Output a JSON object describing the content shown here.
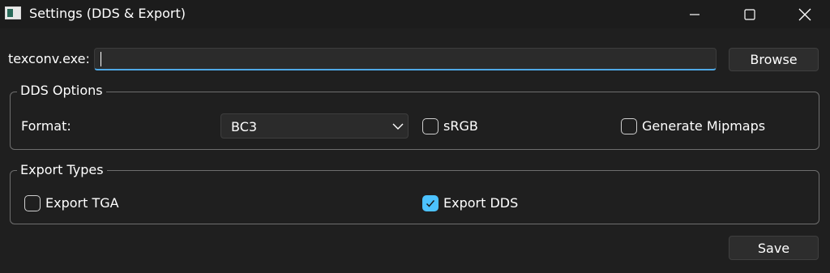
{
  "window": {
    "title": "Settings (DDS & Export)",
    "controls": {
      "minimize": "minimize",
      "maximize": "maximize",
      "close": "close"
    }
  },
  "texconv": {
    "label": "texconv.exe:",
    "value": "",
    "browse_label": "Browse"
  },
  "dds_options": {
    "title": "DDS Options",
    "format_label": "Format:",
    "format_value": "BC3",
    "srgb": {
      "label": "sRGB",
      "checked": false
    },
    "mipmaps": {
      "label": "Generate Mipmaps",
      "checked": false
    }
  },
  "export_types": {
    "title": "Export Types",
    "tga": {
      "label": "Export TGA",
      "checked": false
    },
    "dds": {
      "label": "Export DDS",
      "checked": true
    }
  },
  "actions": {
    "save_label": "Save"
  },
  "colors": {
    "background": "#1f1f1f",
    "accent": "#4cc2ff",
    "input_underline": "#4fa9e6"
  }
}
